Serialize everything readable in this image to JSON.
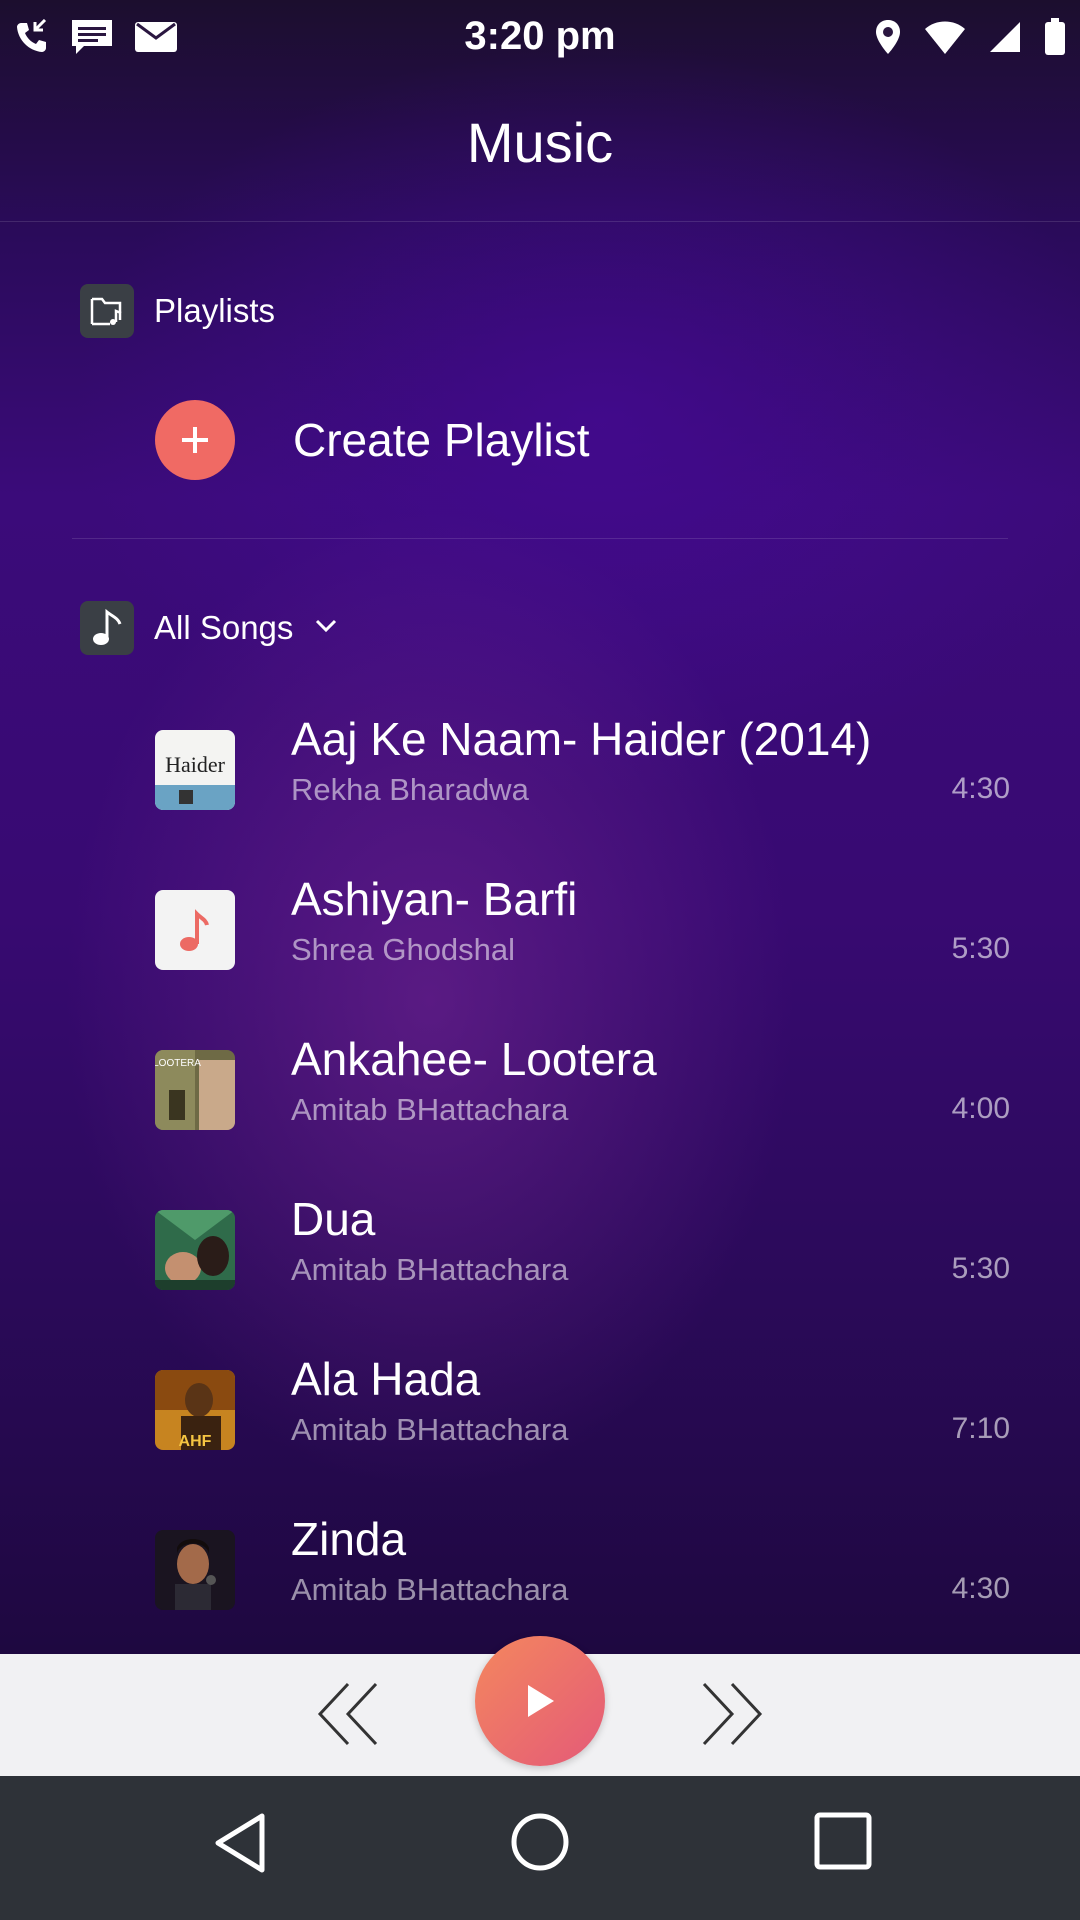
{
  "status_bar": {
    "time": "3:20 pm",
    "left_icons": [
      "phone-call-icon",
      "message-icon",
      "mail-icon"
    ],
    "right_icons": [
      "location-icon",
      "wifi-icon",
      "signal-icon",
      "battery-icon"
    ]
  },
  "header": {
    "title": "Music"
  },
  "playlists": {
    "label": "Playlists",
    "create_label": "Create Playlist"
  },
  "songs_section": {
    "label": "All Songs"
  },
  "songs": [
    {
      "title": "Aaj Ke Naam- Haider (2014)",
      "artist": "Rekha Bharadwa",
      "duration": "4:30",
      "thumb_text": "Haider"
    },
    {
      "title": "Ashiyan- Barfi",
      "artist": "Shrea Ghodshal",
      "duration": "5:30"
    },
    {
      "title": "Ankahee- Lootera",
      "artist": "Amitab BHattachara",
      "duration": "4:00",
      "thumb_text": "LOOTERA"
    },
    {
      "title": "Dua",
      "artist": "Amitab BHattachara",
      "duration": "5:30"
    },
    {
      "title": "Ala Hada",
      "artist": "Amitab BHattachara",
      "duration": "7:10",
      "thumb_text": "AHF"
    },
    {
      "title": "Zinda",
      "artist": "Amitab BHattachara",
      "duration": "4:30"
    }
  ],
  "colors": {
    "accent": "#f06a64",
    "player_bg": "#f1f1f3",
    "nav_bg": "#2e3238"
  }
}
